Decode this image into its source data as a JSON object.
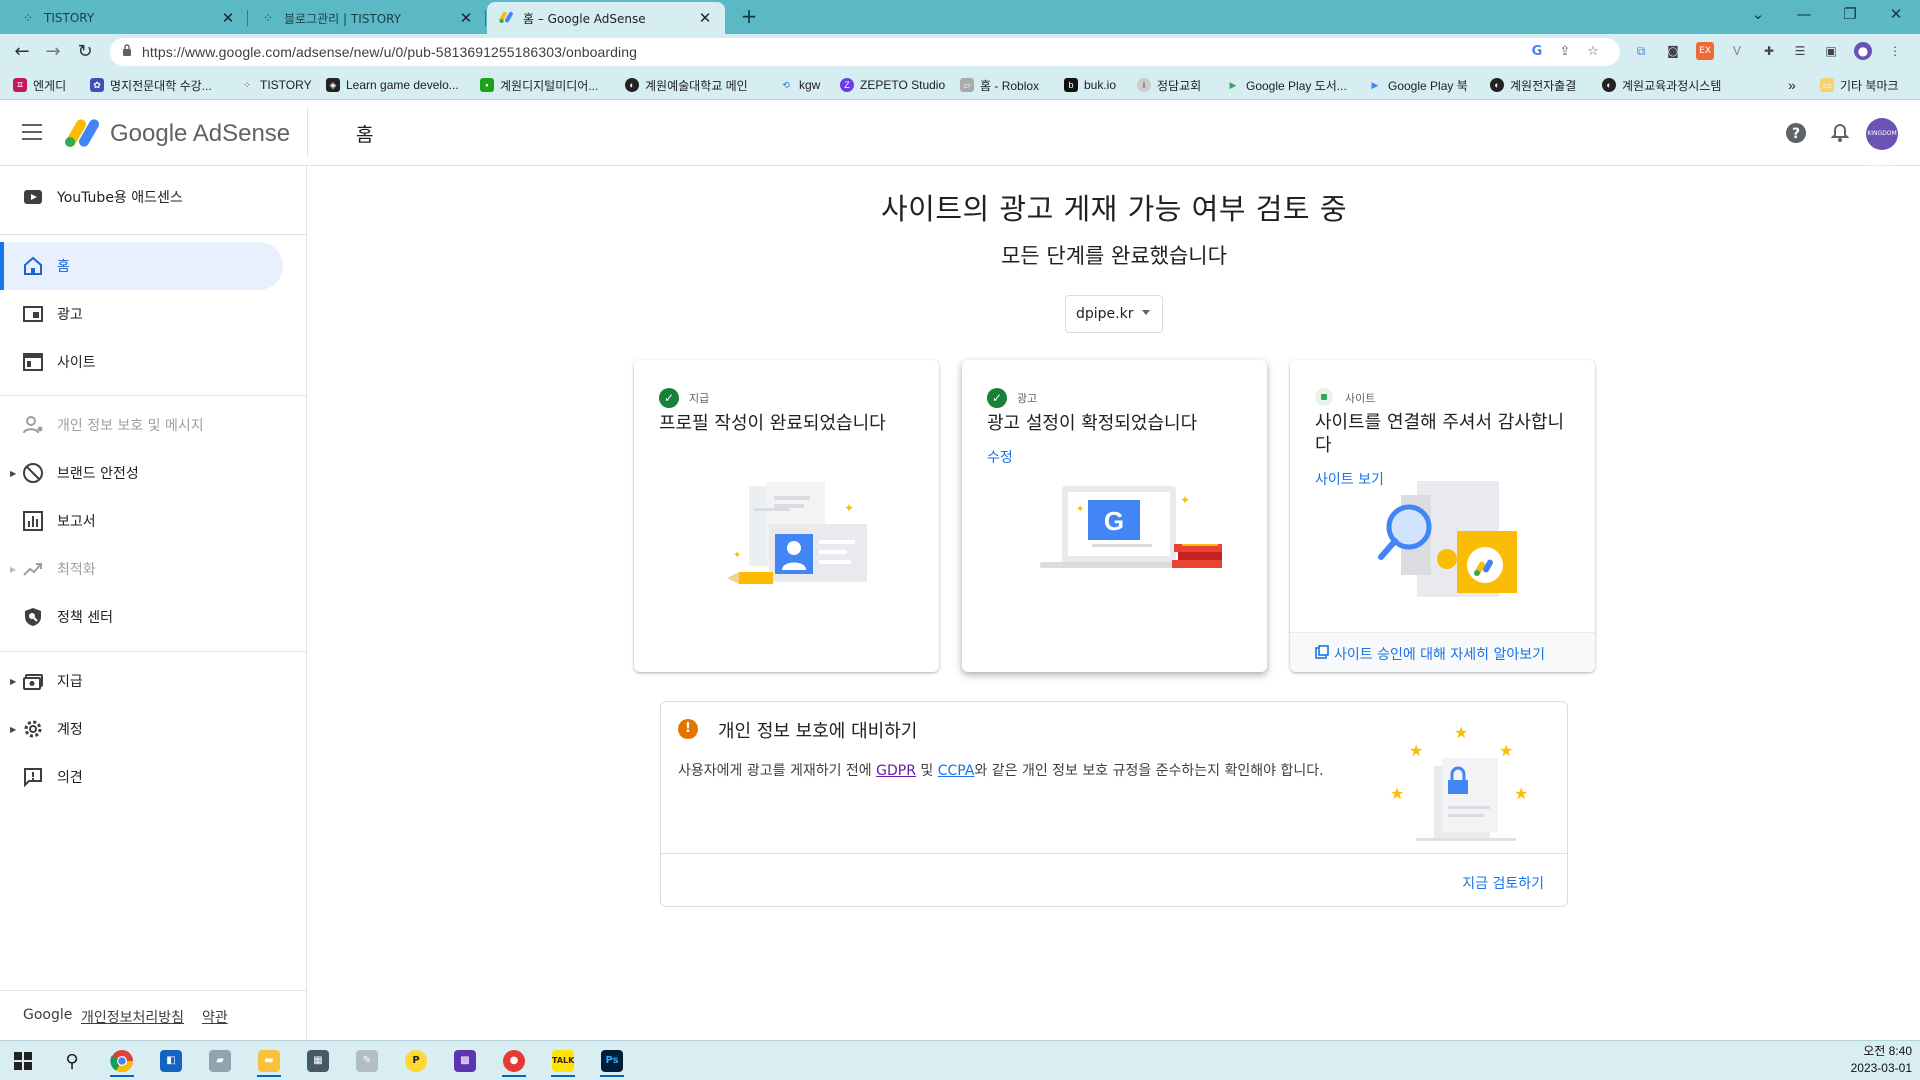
{
  "browser": {
    "tabs": [
      {
        "title": "TISTORY",
        "icon": "tistory-icon"
      },
      {
        "title": "블로그관리 | TISTORY",
        "icon": "tistory-icon"
      },
      {
        "title": "홈 – Google AdSense",
        "icon": "adsense-icon",
        "active": true
      }
    ],
    "url": "https://www.google.com/adsense/new/u/0/pub-5813691255186303/onboarding",
    "bookmarks": [
      {
        "label": "엔게디",
        "color": "#c2185b"
      },
      {
        "label": "명지전문대학 수강...",
        "color": "#3f51b5"
      },
      {
        "label": "TISTORY",
        "color": "#333333"
      },
      {
        "label": "Learn game develo...",
        "color": "#222222"
      },
      {
        "label": "계원디지털미디어...",
        "color": "#1aa31a"
      },
      {
        "label": "계원예술대학교 메인",
        "color": "#222222"
      },
      {
        "label": "kgw",
        "color": "#1a73e8"
      },
      {
        "label": "ZEPETO Studio",
        "color": "#6a3de8"
      },
      {
        "label": "홈 - Roblox",
        "color": "#888888"
      },
      {
        "label": "buk.io",
        "color": "#111111"
      },
      {
        "label": "정담교회",
        "color": "#666666"
      },
      {
        "label": "Google Play 도서...",
        "color": "#34a853"
      },
      {
        "label": "Google Play 북",
        "color": "#4285f4"
      },
      {
        "label": "계원전자출결",
        "color": "#222222"
      },
      {
        "label": "계원교육과정시스템",
        "color": "#222222"
      }
    ],
    "more_bookmarks": "»",
    "other_bookmarks": "기타 북마크"
  },
  "app": {
    "brand": "Google AdSense",
    "page_title": "홈",
    "avatar_text": "KINGDOM CAMPUS"
  },
  "sidebar": {
    "youtube": "YouTube용 애드센스",
    "home": "홈",
    "ads": "광고",
    "sites": "사이트",
    "privacy_messages": "개인 정보 보호 및 메시지",
    "brand_safety": "브랜드 안전성",
    "reports": "보고서",
    "optimization": "최적화",
    "policy_center": "정책 센터",
    "payments": "지급",
    "account": "계정",
    "feedback": "의견",
    "footer": {
      "google": "Google",
      "privacy": "개인정보처리방침",
      "terms": "약관"
    }
  },
  "main": {
    "heading": "사이트의 광고 게재 가능 여부 검토 중",
    "subheading": "모든 단계를 완료했습니다",
    "site_selector": "dpipe.kr",
    "cards": [
      {
        "kicker": "지급",
        "title": "프로필 작성이 완료되었습니다"
      },
      {
        "kicker": "광고",
        "title": "광고 설정이 확정되었습니다",
        "link": "수정"
      },
      {
        "kicker": "사이트",
        "title": "사이트를 연결해 주셔서 감사합니다",
        "link": "사이트 보기",
        "footer_link": "사이트 승인에 대해 자세히 알아보기"
      }
    ],
    "privacy": {
      "title": "개인 정보 보호에 대비하기",
      "body_before": "사용자에게 광고를 게재하기 전에 ",
      "gdpr": "GDPR",
      "and": " 및 ",
      "ccpa": "CCPA",
      "body_after": "와 같은 개인 정보 보호 규정을 준수하는지 확인해야 합니다.",
      "action": "지금 검토하기"
    }
  },
  "colors": {
    "accent": "#1a73e8",
    "success": "#188038",
    "warning": "#e37400",
    "chrome": "#5bb8c5"
  },
  "taskbar": {
    "time": "오전 8:40",
    "date": "2023-03-01"
  }
}
